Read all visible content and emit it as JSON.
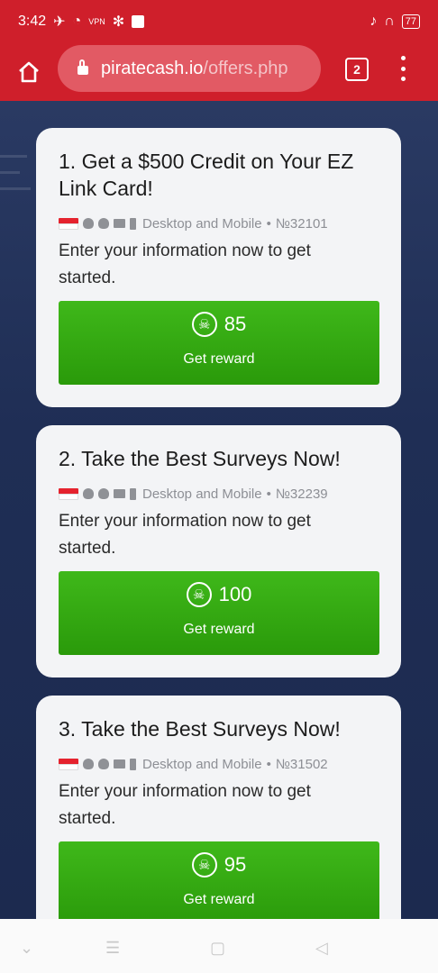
{
  "status_bar": {
    "time": "3:42",
    "vpn": "VPN",
    "battery": "77"
  },
  "browser": {
    "url_domain": "piratecash.io",
    "url_path": "/offers.php",
    "tab_count": "2"
  },
  "offers": [
    {
      "title": "1. Get a $500 Credit on Your EZ Link Card!",
      "platforms": "Desktop and Mobile",
      "offer_id": "№32101",
      "description": "Enter your information now to get started.",
      "points": "85",
      "button_label": "Get reward"
    },
    {
      "title": "2. Take the Best Surveys Now!",
      "platforms": "Desktop and Mobile",
      "offer_id": "№32239",
      "description": "Enter your information now to get started.",
      "points": "100",
      "button_label": "Get reward"
    },
    {
      "title": "3. Take the Best Surveys Now!",
      "platforms": "Desktop and Mobile",
      "offer_id": "№31502",
      "description": "Enter your information now to get started.",
      "points": "95",
      "button_label": "Get reward"
    }
  ],
  "colors": {
    "browser_red": "#cf1f2b",
    "reward_green": "#2a9a0a",
    "page_bg": "#1e2d52"
  }
}
